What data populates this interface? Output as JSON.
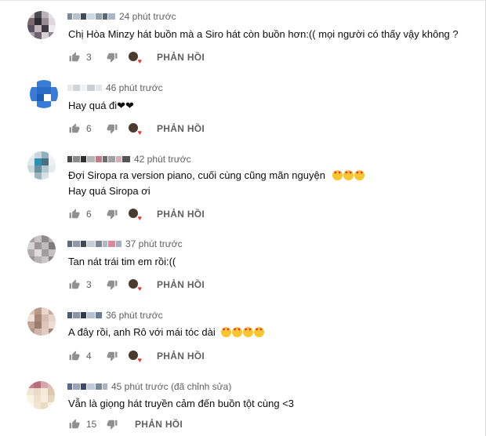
{
  "comments": [
    {
      "time": "24 phút trước",
      "lines": [
        "Chị Hòa Minzy hát buồn mà a Siro hát còn buồn hơn:(( mọi người có thấy vậy không ?"
      ],
      "likes": "3",
      "reply": "PHẢN HỒI",
      "avatar_colors": [
        "#c8c2c6",
        "#4e4a52",
        "#b8b2b8",
        "#e4e0e4",
        "#7a6a70",
        "#2f2c33",
        "#998d94",
        "#ded8dc",
        "#5a5060",
        "#c2b8bc",
        "#3d3a42",
        "#efeaee",
        "#a6a0a8",
        "#6e6470",
        "#d6d0d4",
        "#8d8590"
      ],
      "name_blur": [
        "#7e8a9a",
        "#b7c1cf",
        "#3f4a5a",
        "#cfd7e3",
        "#94a0b0",
        "#5b6676",
        "#aab6c4"
      ]
    },
    {
      "time": "46 phút trước",
      "lines": [
        "Hay quá đi❤❤"
      ],
      "likes": "6",
      "reply": "PHẢN HỒI",
      "avatar_colors": [
        "#ffffff",
        "#3a7bd5",
        "#3a7bd5",
        "#ffffff",
        "#3a7bd5",
        "#2b6cc4",
        "#2b6cc4",
        "#3a7bd5",
        "#3a7bd5",
        "#1f5fb5",
        "#ffffff",
        "#3a7bd5",
        "#ffffff",
        "#3a7bd5",
        "#3a7bd5",
        "#ffffff"
      ],
      "name_blur": [
        "#e8e8e8",
        "#d0d4dc",
        "#f1f1f1",
        "#c9ced6",
        "#e3e5e9"
      ]
    },
    {
      "time": "42 phút trước",
      "lines": [
        "Đợi Siropa ra version piano, cuối cùng cũng mãn nguyện",
        "Hay quá Siropa ơi"
      ],
      "emoji_count": 3,
      "likes": "6",
      "reply": "PHẢN HỒI",
      "avatar_colors": [
        "#e9eef2",
        "#c9d6de",
        "#8fb1c2",
        "#f2f4f6",
        "#dfe7ec",
        "#2f8fb0",
        "#4a6f80",
        "#eef1f3",
        "#cdd8de",
        "#6a8f9d",
        "#b2c6cf",
        "#e5eaed",
        "#f4f6f7",
        "#9fb5bf",
        "#d8e1e5",
        "#ffffff"
      ],
      "name_blur": [
        "#4a4a4a",
        "#8c8c8c",
        "#2f2f2f",
        "#b5b5b5",
        "#c47a8a",
        "#6b6b6b",
        "#a0a0a0",
        "#d4b0b8",
        "#555555"
      ]
    },
    {
      "time": "37 phút trước",
      "lines": [
        "Tan nát trái tim em rồi:(("
      ],
      "likes": "3",
      "reply": "PHẢN HỒI",
      "avatar_colors": [
        "#a8a4a6",
        "#c8c4c6",
        "#8e8a8c",
        "#b6b2b4",
        "#d6d2d4",
        "#9c989a",
        "#bfbbbd",
        "#7f7b7d",
        "#b0acae",
        "#e0dcde",
        "#a29ea0",
        "#c4c0c2",
        "#9a9698",
        "#b8b4b6",
        "#cac6c8",
        "#8a8688"
      ],
      "name_blur": [
        "#5d6a7a",
        "#8e9aab",
        "#3e4a5a",
        "#c6cdd7",
        "#7a8696",
        "#b0b9c6",
        "#d88aa0",
        "#a6b0bd"
      ]
    },
    {
      "time": "36 phút trước",
      "lines": [
        "A đây rồi, anh Rô với mái tóc dài"
      ],
      "emoji_count": 4,
      "likes": "4",
      "reply": "PHẢN HỒI",
      "avatar_colors": [
        "#d9c4b8",
        "#b89a8c",
        "#e8d6cc",
        "#c7ab9e",
        "#f0e2da",
        "#a88778",
        "#d4bcb0",
        "#e6d2c8",
        "#c2a496",
        "#9c7c6e",
        "#dcc6ba",
        "#eddcd2",
        "#b49486",
        "#d0b6a8",
        "#e2ccc0",
        "#a48476"
      ],
      "name_blur": [
        "#4a5a72",
        "#8896ac",
        "#2a3a52",
        "#b6c0d0",
        "#6a7a92"
      ]
    },
    {
      "time": "45 phút trước (đã chỉnh sửa)",
      "lines": [
        "Vẫn là giọng hát truyền cảm đến buồn tột cùng <3"
      ],
      "likes": "15",
      "reply": "PHẢN HỒI",
      "avatar_colors": [
        "#c7808e",
        "#b86c7c",
        "#d8a4ae",
        "#e2bcc4",
        "#f0e6d8",
        "#e8dcc8",
        "#f4ead6",
        "#dcc8b0",
        "#fbf3e4",
        "#efe2cc",
        "#f6eede",
        "#e6d6bc",
        "#fff8ea",
        "#f2e6d2",
        "#eadcc4",
        "#f8f0e0"
      ],
      "name_blur": [
        "#5a6a8a",
        "#9aa6ba",
        "#3a4a6a",
        "#c2cad8",
        "#7a889e",
        "#aab4c4"
      ]
    }
  ]
}
